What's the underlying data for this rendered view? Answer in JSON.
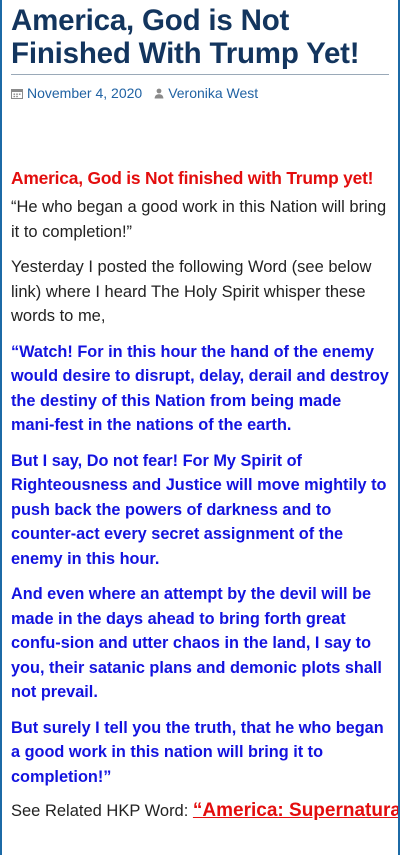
{
  "post": {
    "title": "America, God is Not Finished With Trump Yet!",
    "date": "November 4, 2020",
    "author": "Veronika West",
    "icons": {
      "date": "calendar-icon",
      "author": "user-icon"
    }
  },
  "content": {
    "headline": "America, God is Not finished with Trump yet!",
    "intro": "“He who began a good work in this Nation will bring it to completion!”",
    "context": "Yesterday I posted the following Word (see below link) where I heard The Holy Spirit whisper these words to me,",
    "quote": [
      "“Watch! For in this hour the hand of the enemy would desire to disrupt, delay, derail and destroy the destiny of this Nation from being made mani-fest in the nations of the earth.",
      "But I say, Do not fear! For My Spirit of Righteousness and Justice will move mightily to push back the powers of darkness and to counter-act every secret assignment of the enemy in this hour.",
      "And even where an attempt by the devil will be made in the days ahead to bring forth great confu-sion and utter chaos in the land, I say to you, their satanic plans and demonic plots shall not prevail.",
      "But surely I tell you the truth, that he who began a good work in this nation will bring it to completion!”"
    ],
    "related_label": "See Related HKP Word:",
    "related_link": "“America: Supernatural"
  },
  "colors": {
    "title": "#13355e",
    "link": "#2062a3",
    "red": "#e30d0d",
    "blue_text": "#1313e0",
    "border": "#1c6aa6"
  }
}
